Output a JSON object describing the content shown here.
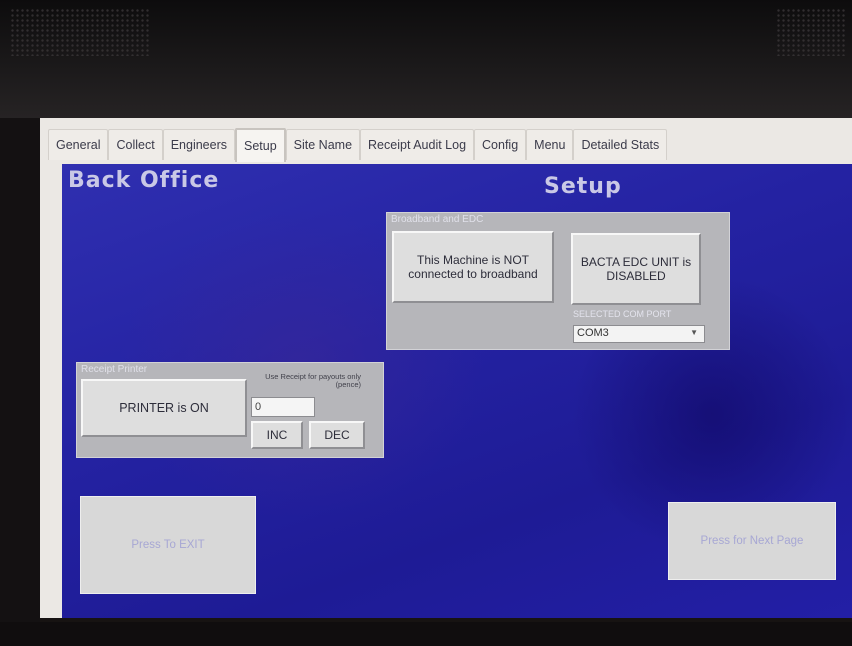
{
  "tabs": [
    {
      "label": "General"
    },
    {
      "label": "Collect"
    },
    {
      "label": "Engineers"
    },
    {
      "label": "Setup",
      "active": true
    },
    {
      "label": "Site Name"
    },
    {
      "label": "Receipt Audit Log"
    },
    {
      "label": "Config"
    },
    {
      "label": "Menu"
    },
    {
      "label": "Detailed Stats"
    }
  ],
  "header": {
    "left_title": "Back Office",
    "page_title": "Setup"
  },
  "broadband_group": {
    "title": "Broadband and EDC",
    "broadband_button": "This Machine is NOT connected to broadband",
    "edc_button": "BACTA EDC UNIT is DISABLED",
    "com_port_label": "SELECTED COM PORT",
    "com_port_value": "COM3"
  },
  "printer_group": {
    "title": "Receipt Printer",
    "printer_button": "PRINTER is ON",
    "counter_label": "Use Receipt for payouts only (pence)",
    "counter_value": "0",
    "inc_label": "INC",
    "dec_label": "DEC"
  },
  "footer": {
    "exit_button": "Press To EXIT",
    "next_button": "Press for Next Page"
  },
  "colors": {
    "panel_blue": "#2422a2",
    "button_grey": "#dedede",
    "group_grey": "#b6b6ba"
  }
}
